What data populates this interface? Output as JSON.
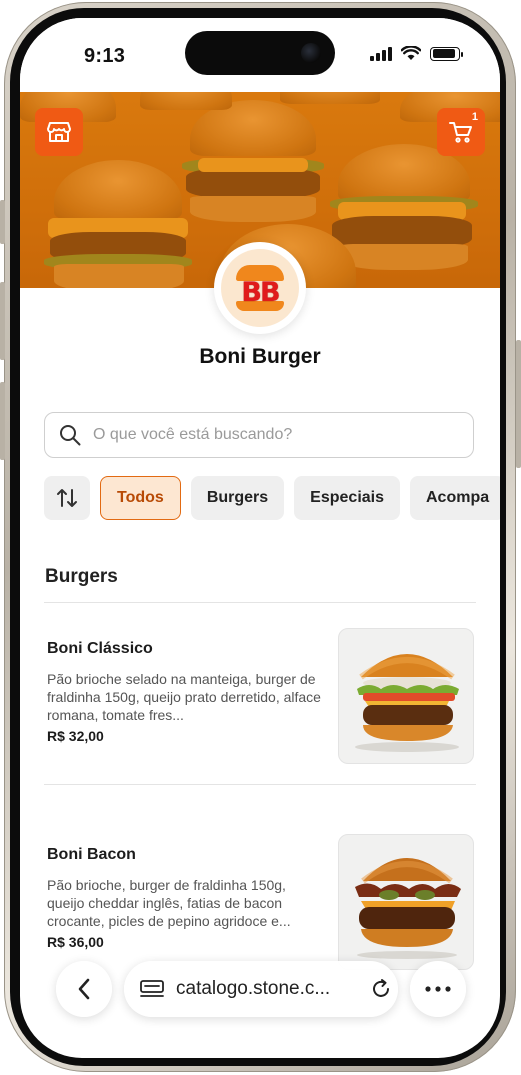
{
  "status_bar": {
    "time": "9:13"
  },
  "header": {
    "store_icon": "storefront-icon",
    "cart_icon": "shopping-cart-icon",
    "cart_count": "1",
    "brand_color": "#f05a14"
  },
  "store": {
    "name": "Boni Burger",
    "logo_text": "BB"
  },
  "search": {
    "placeholder": "O que você está buscando?",
    "value": ""
  },
  "filters": {
    "sort_icon": "sort-arrows-icon",
    "chips": [
      {
        "label": "Todos",
        "active": true
      },
      {
        "label": "Burgers",
        "active": false
      },
      {
        "label": "Especiais",
        "active": false
      },
      {
        "label": "Acompa",
        "active": false
      }
    ]
  },
  "section": {
    "title": "Burgers"
  },
  "products": [
    {
      "name": "Boni Clássico",
      "description": "Pão brioche selado na manteiga, burger de fraldinha 150g, queijo prato derretido, alface romana, tomate fres...",
      "price": "R$ 32,00"
    },
    {
      "name": "Boni Bacon",
      "description": "Pão brioche, burger de fraldinha 150g, queijo cheddar inglês, fatias de bacon crocante, picles de pepino agridoce e...",
      "price": "R$ 36,00"
    }
  ],
  "browser": {
    "url": "catalogo.stone.c...",
    "back_icon": "chevron-left-icon",
    "tabs_icon": "page-list-icon",
    "reload_icon": "reload-icon",
    "more_icon": "more-dots-icon"
  },
  "colors": {
    "accent": "#e26a12",
    "accent_bg": "#fde7d2",
    "chip_bg": "#efefef"
  }
}
